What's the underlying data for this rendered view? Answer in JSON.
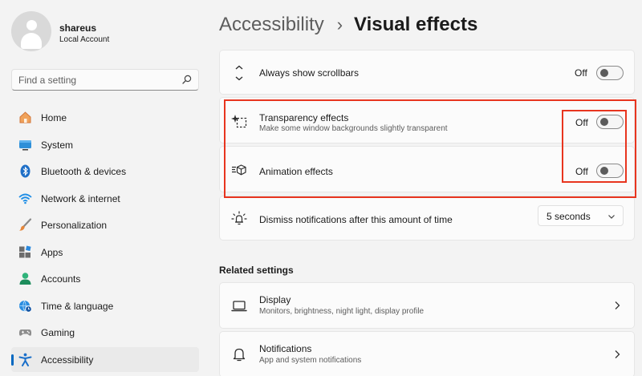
{
  "user": {
    "name": "shareus",
    "account_type": "Local Account"
  },
  "search": {
    "placeholder": "Find a setting",
    "value": ""
  },
  "nav": {
    "items": [
      {
        "label": "Home",
        "icon": "home-icon"
      },
      {
        "label": "System",
        "icon": "system-icon"
      },
      {
        "label": "Bluetooth & devices",
        "icon": "bluetooth-icon"
      },
      {
        "label": "Network & internet",
        "icon": "wifi-icon"
      },
      {
        "label": "Personalization",
        "icon": "brush-icon"
      },
      {
        "label": "Apps",
        "icon": "apps-icon"
      },
      {
        "label": "Accounts",
        "icon": "account-icon"
      },
      {
        "label": "Time & language",
        "icon": "globe-clock-icon"
      },
      {
        "label": "Gaming",
        "icon": "gamepad-icon"
      },
      {
        "label": "Accessibility",
        "icon": "accessibility-icon"
      }
    ],
    "active": "Accessibility"
  },
  "breadcrumb": {
    "parent": "Accessibility",
    "separator": "›",
    "current": "Visual effects"
  },
  "settings": {
    "scrollbars": {
      "title": "Always show scrollbars",
      "state": "Off",
      "icon": "scroll-arrows-icon"
    },
    "transparency": {
      "title": "Transparency effects",
      "description": "Make some window backgrounds slightly transparent",
      "state": "Off",
      "icon": "transparency-icon"
    },
    "animation": {
      "title": "Animation effects",
      "state": "Off",
      "icon": "animation-icon"
    },
    "notifications_timeout": {
      "title": "Dismiss notifications after this amount of time",
      "value": "5 seconds",
      "icon": "notification-sun-icon"
    }
  },
  "related": {
    "heading": "Related settings",
    "items": [
      {
        "title": "Display",
        "description": "Monitors, brightness, night light, display profile",
        "icon": "laptop-icon"
      },
      {
        "title": "Notifications",
        "description": "App and system notifications",
        "icon": "bell-icon"
      }
    ]
  },
  "colors": {
    "accent": "#0067c0",
    "highlight": "#e8351f",
    "background": "#f3f3f3",
    "card": "#fbfbfb"
  }
}
